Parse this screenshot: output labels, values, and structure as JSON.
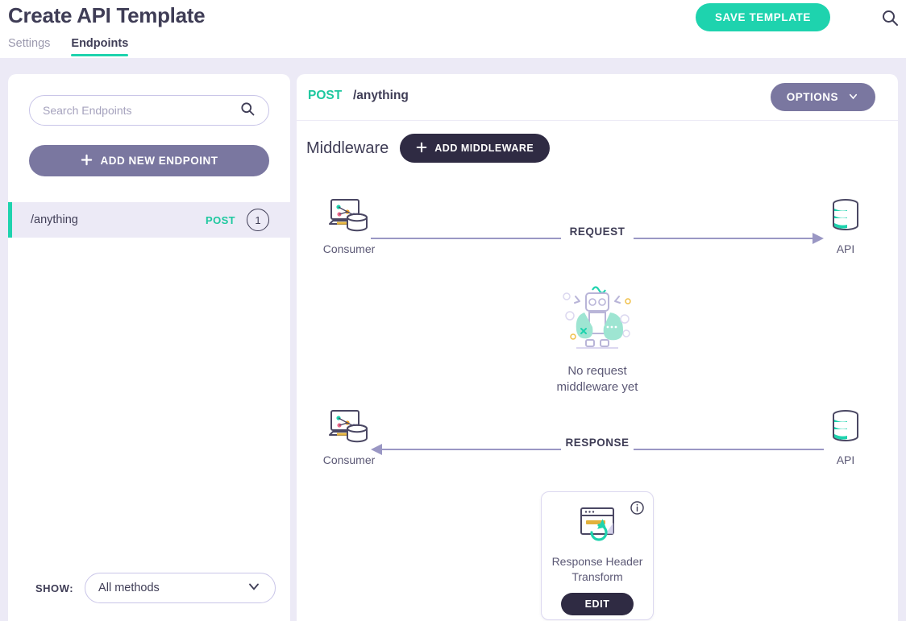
{
  "header": {
    "title": "Create API Template",
    "save_label": "SAVE TEMPLATE",
    "search_icon": "search-icon",
    "tabs": [
      {
        "label": "Settings",
        "active": false
      },
      {
        "label": "Endpoints",
        "active": true
      }
    ]
  },
  "sidebar": {
    "search_placeholder": "Search Endpoints",
    "search_value": "",
    "search_icon": "search-icon",
    "add_endpoint_label": "ADD NEW ENDPOINT",
    "add_icon": "plus-icon",
    "endpoints": [
      {
        "path": "/anything",
        "method": "POST",
        "count": "1",
        "selected": true
      }
    ],
    "show_label": "SHOW:",
    "show_value": "All methods",
    "show_options": [
      "All methods"
    ],
    "show_icon": "chevron-down-icon"
  },
  "main": {
    "method": "POST",
    "path": "/anything",
    "options_label": "OPTIONS",
    "options_icon": "chevron-down-icon",
    "middleware_title": "Middleware",
    "add_middleware_label": "ADD MIDDLEWARE",
    "add_middleware_icon": "plus-icon",
    "request_flow": {
      "left_label": "Consumer",
      "right_label": "API",
      "arrow_label": "REQUEST",
      "direction": "right"
    },
    "response_flow": {
      "left_label": "Consumer",
      "right_label": "API",
      "arrow_label": "RESPONSE",
      "direction": "left"
    },
    "empty_state": {
      "line1": "No request",
      "line2": "middleware yet",
      "illustration": "robot-illustration"
    },
    "middleware_card": {
      "name_line1": "Response Header",
      "name_line2": "Transform",
      "edit_label": "EDIT",
      "info_icon": "info-icon",
      "icon": "browser-refresh-icon"
    }
  },
  "colors": {
    "accent_teal": "#1ed3ae",
    "purple": "#7a77a0",
    "dark": "#2f2b43",
    "text": "#3f3d56",
    "page_bg": "#eceaf6"
  }
}
